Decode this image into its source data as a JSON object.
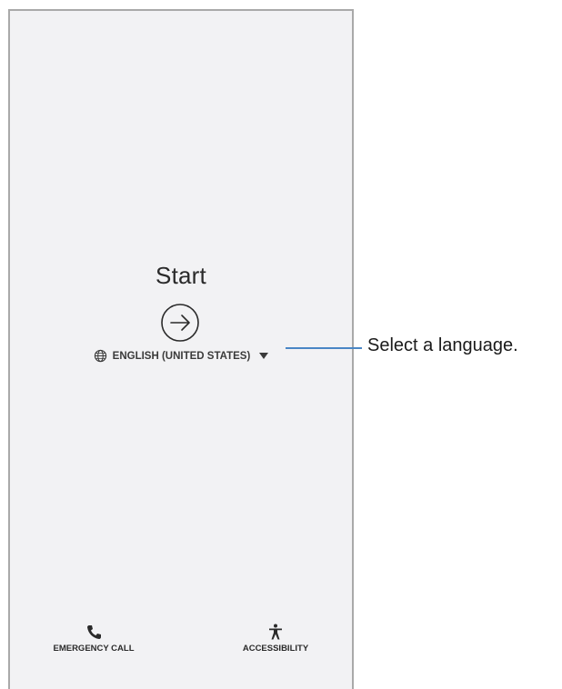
{
  "welcome": {
    "title": "Start",
    "language_label": "ENGLISH (UNITED STATES)"
  },
  "bottom_bar": {
    "emergency_label": "EMERGENCY CALL",
    "accessibility_label": "ACCESSIBILITY"
  },
  "annotation": {
    "callout_text": "Select a language."
  },
  "icons": {
    "start": "arrow-circle-right-icon",
    "language": "globe-icon",
    "dropdown": "triangle-down-icon",
    "emergency": "phone-icon",
    "accessibility": "accessibility-person-icon"
  },
  "colors": {
    "screen_bg": "#f2f2f4",
    "text": "#2a2a2a",
    "callout_line": "#4a86c5",
    "frame_border": "#a9a9a9"
  }
}
